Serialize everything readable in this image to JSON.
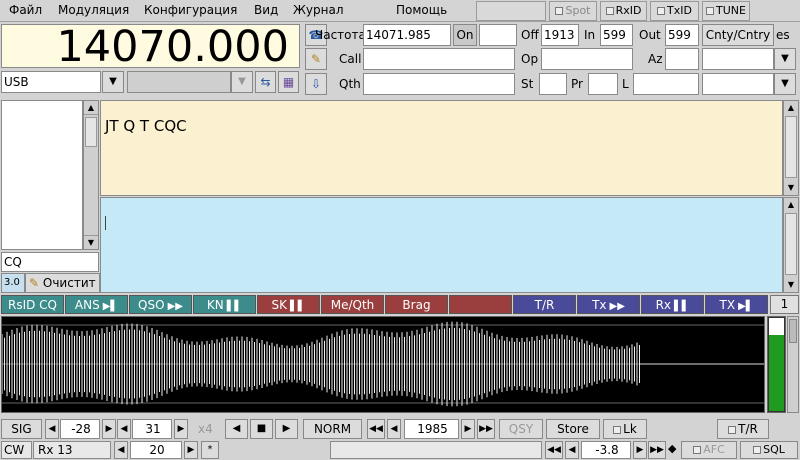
{
  "menu": {
    "items": [
      "Файл",
      "Модуляция",
      "Конфигурация",
      "Вид",
      "Журнал",
      "Помощь"
    ],
    "toggles": {
      "spot": "Spot",
      "rxid": "RxID",
      "txid": "TxID",
      "tune": "TUNE"
    }
  },
  "freq": {
    "display": "14070.000",
    "mode": "USB"
  },
  "log": {
    "freq_label": "Частота",
    "freq_value": "14071.985",
    "on_label": "On",
    "off_label": "Off",
    "off_value": "1913",
    "in_label": "In",
    "in_value": "599",
    "out_label": "Out",
    "out_value": "599",
    "cnty_label": "Cnty/Cntry",
    "es_label": "es",
    "call_label": "Call",
    "op_label": "Op",
    "az_label": "Az",
    "qth_label": "Qth",
    "st_label": "St",
    "pr_label": "Pr",
    "l_label": "L"
  },
  "rx_text": "JT Q T CQC",
  "side": {
    "cq_value": "CQ",
    "version_value": "3.0",
    "clear_label": "Очистит"
  },
  "macros": [
    {
      "label": "RsID CQ",
      "icon": "",
      "color": "#3d8c8c"
    },
    {
      "label": "ANS",
      "icon": "▶▌",
      "color": "#3d8c8c"
    },
    {
      "label": "QSO",
      "icon": "▶▶",
      "color": "#3d8c8c"
    },
    {
      "label": "KN",
      "icon": "▌▌",
      "color": "#3d8c8c"
    },
    {
      "label": "SK",
      "icon": "▌▌",
      "color": "#9a3e3e"
    },
    {
      "label": "Me/Qth",
      "icon": "",
      "color": "#9a3e3e"
    },
    {
      "label": "Brag",
      "icon": "",
      "color": "#9a3e3e"
    },
    {
      "label": "",
      "icon": "",
      "color": "#9a3e3e"
    },
    {
      "label": "T/R",
      "icon": "",
      "color": "#4a4a9a"
    },
    {
      "label": "Tx",
      "icon": "▶▶",
      "color": "#4a4a9a"
    },
    {
      "label": "Rx",
      "icon": "▌▌",
      "color": "#4a4a9a"
    },
    {
      "label": "TX",
      "icon": "▶▌",
      "color": "#4a4a9a"
    }
  ],
  "macro_page": "1",
  "bottom": {
    "sig_label": "SIG",
    "squelch_value": "-28",
    "gain_value": "31",
    "x4_label": "x4",
    "norm_label": "NORM",
    "carrier_value": "1985",
    "qsy_label": "QSY",
    "store_label": "Store",
    "lk_label": "Lk",
    "tr_label": "T/R",
    "status_mode": "CW",
    "status_rx": "Rx 13",
    "status_val": "20",
    "status_star": "*",
    "status_db": "-3.8",
    "afc_label": "AFC",
    "sql_label": "SQL"
  },
  "colors": {
    "freq_bg": "#fffbe0",
    "rx_bg": "#fbf0d0",
    "tx_bg": "#c6e9f8",
    "signal_level": 0.82
  }
}
